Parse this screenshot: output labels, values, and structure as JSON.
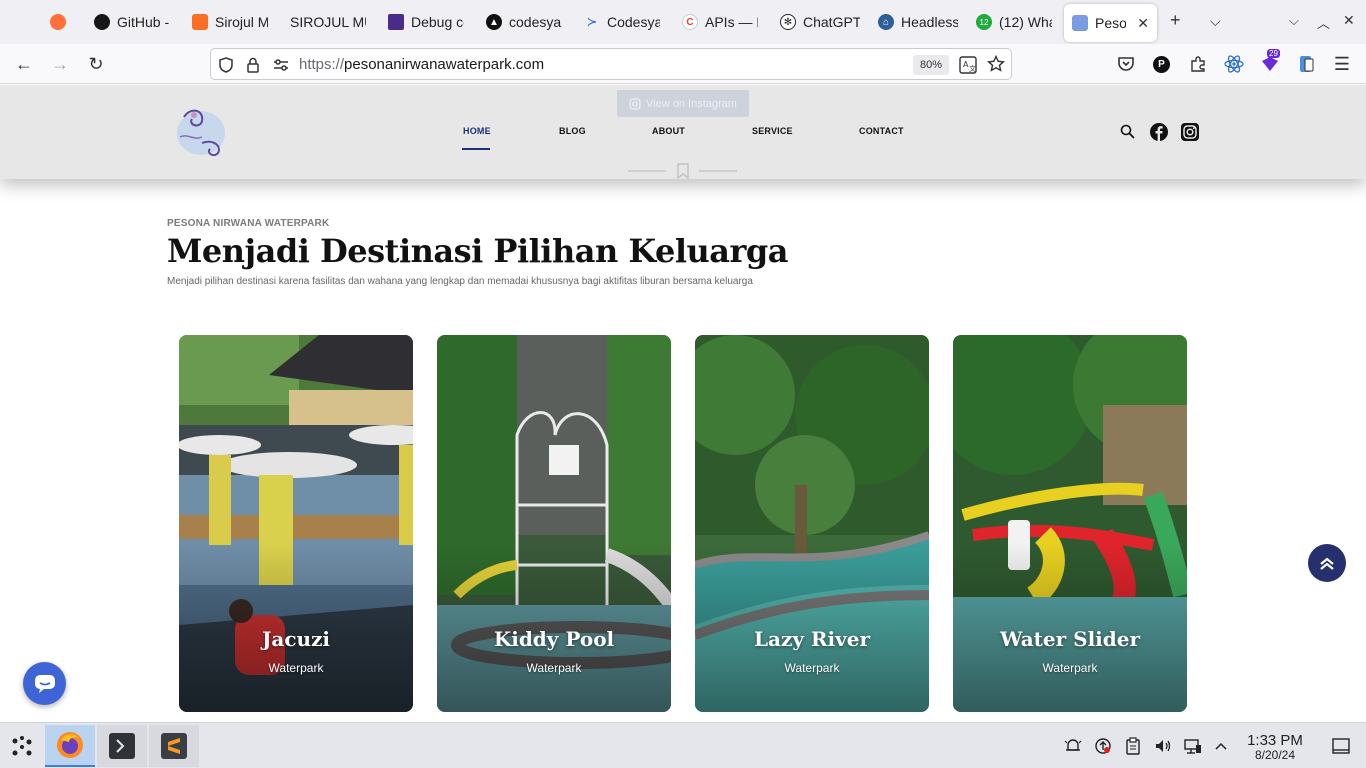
{
  "browser": {
    "tabs": [
      {
        "label": "",
        "icon": "firefox-icon",
        "color": "#ff7139"
      },
      {
        "label": "GitHub -",
        "icon": "github-icon",
        "color": "#181717"
      },
      {
        "label": "Sirojul M",
        "icon": "gitlab-icon",
        "color": "#fc6d26"
      },
      {
        "label": "SIROJUL MU",
        "icon": "",
        "color": ""
      },
      {
        "label": "Debug cc",
        "icon": "debug-icon",
        "color": "#4a2a8a"
      },
      {
        "label": "codesyar",
        "icon": "codesyariah-icon",
        "color": "#111111"
      },
      {
        "label": "Codesyar",
        "icon": "powershell-icon",
        "color": "#2a63d8"
      },
      {
        "label": "APIs — M",
        "icon": "apis-icon",
        "color": "#e0453a"
      },
      {
        "label": "ChatGPT",
        "icon": "chatgpt-icon",
        "color": "#222222"
      },
      {
        "label": "Headless",
        "icon": "headless-icon",
        "color": "#2d5f9a"
      },
      {
        "label": "(12) Wha",
        "icon": "whatsapp-icon",
        "color": "#1faa3b",
        "badge": "12"
      },
      {
        "label": "Peson",
        "icon": "pesona-icon",
        "color": "#7a9ce0",
        "active": true
      }
    ],
    "new_tab": "+",
    "url_scheme": "https://",
    "url_host": "pesonanirwanawaterpark.com",
    "zoom": "80%",
    "extension_badge": "29"
  },
  "site": {
    "ig_button": "View on Instagram",
    "menu": [
      {
        "label": "HOME",
        "active": true
      },
      {
        "label": "BLOG"
      },
      {
        "label": "ABOUT"
      },
      {
        "label": "SERVICE"
      },
      {
        "label": "CONTACT"
      }
    ],
    "eyebrow": "PESONA NIRWANA WATERPARK",
    "headline": "Menjadi Destinasi Pilihan Keluarga",
    "subline": "Menjadi pilihan destinasi karena fasilitas dan wahana yang lengkap dan memadai khususnya bagi aktifitas liburan bersama keluarga",
    "cards": [
      {
        "title": "Jacuzi",
        "subtitle": "Waterpark"
      },
      {
        "title": "Kiddy Pool",
        "subtitle": "Waterpark"
      },
      {
        "title": "Lazy River",
        "subtitle": "Waterpark"
      },
      {
        "title": "Water Slider",
        "subtitle": "Waterpark"
      }
    ]
  },
  "taskbar": {
    "time": "1:33 PM",
    "date": "8/20/24"
  },
  "colors": {
    "brand": "#1f2f7a",
    "scroll_top": "#26306f",
    "chat": "#3e64d6"
  }
}
